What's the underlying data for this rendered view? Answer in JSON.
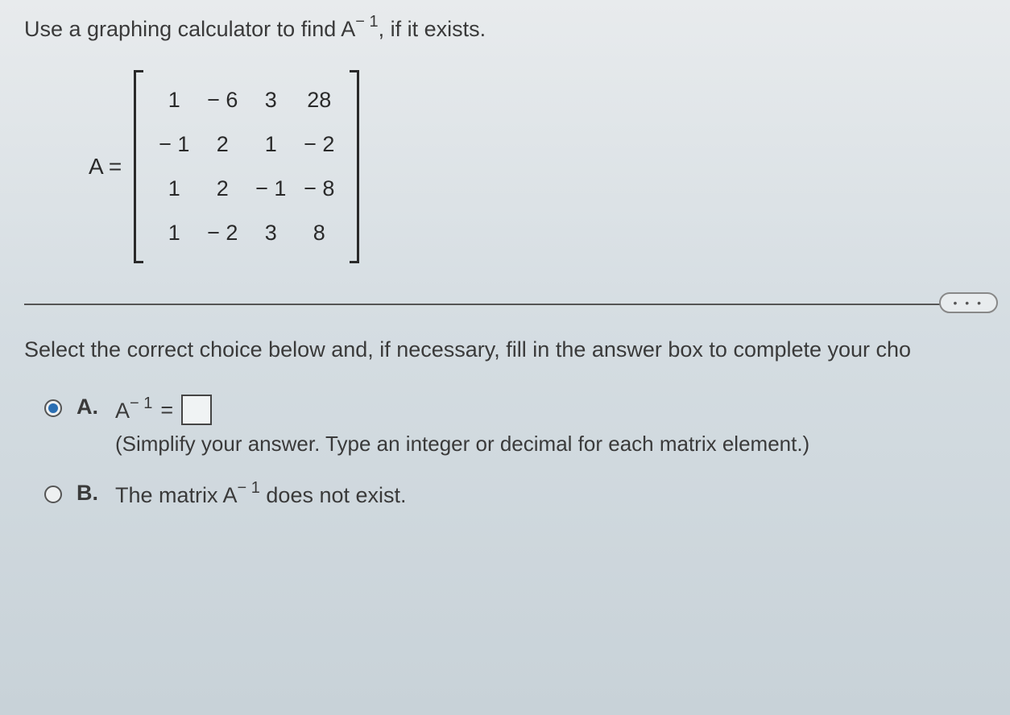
{
  "question": {
    "prefix": "Use a graphing calculator to find A",
    "exponent": "− 1",
    "suffix": ", if it exists."
  },
  "matrix": {
    "label": "A =",
    "rows": [
      [
        "1",
        "− 6",
        "3",
        "28"
      ],
      [
        "− 1",
        "2",
        "1",
        "− 2"
      ],
      [
        "1",
        "2",
        "− 1",
        "− 8"
      ],
      [
        "1",
        "− 2",
        "3",
        "8"
      ]
    ]
  },
  "instruction": "Select the correct choice below and, if necessary, fill in the answer box to complete your cho",
  "choices": {
    "a": {
      "letter": "A.",
      "expr_base": "A",
      "expr_exp": "− 1",
      "expr_eq": "=",
      "hint": "(Simplify your answer. Type an integer or decimal for each matrix element.)",
      "selected": true
    },
    "b": {
      "letter": "B.",
      "text_prefix": "The matrix A",
      "text_exp": "− 1",
      "text_suffix": " does not exist.",
      "selected": false
    }
  },
  "dots": "• • •"
}
